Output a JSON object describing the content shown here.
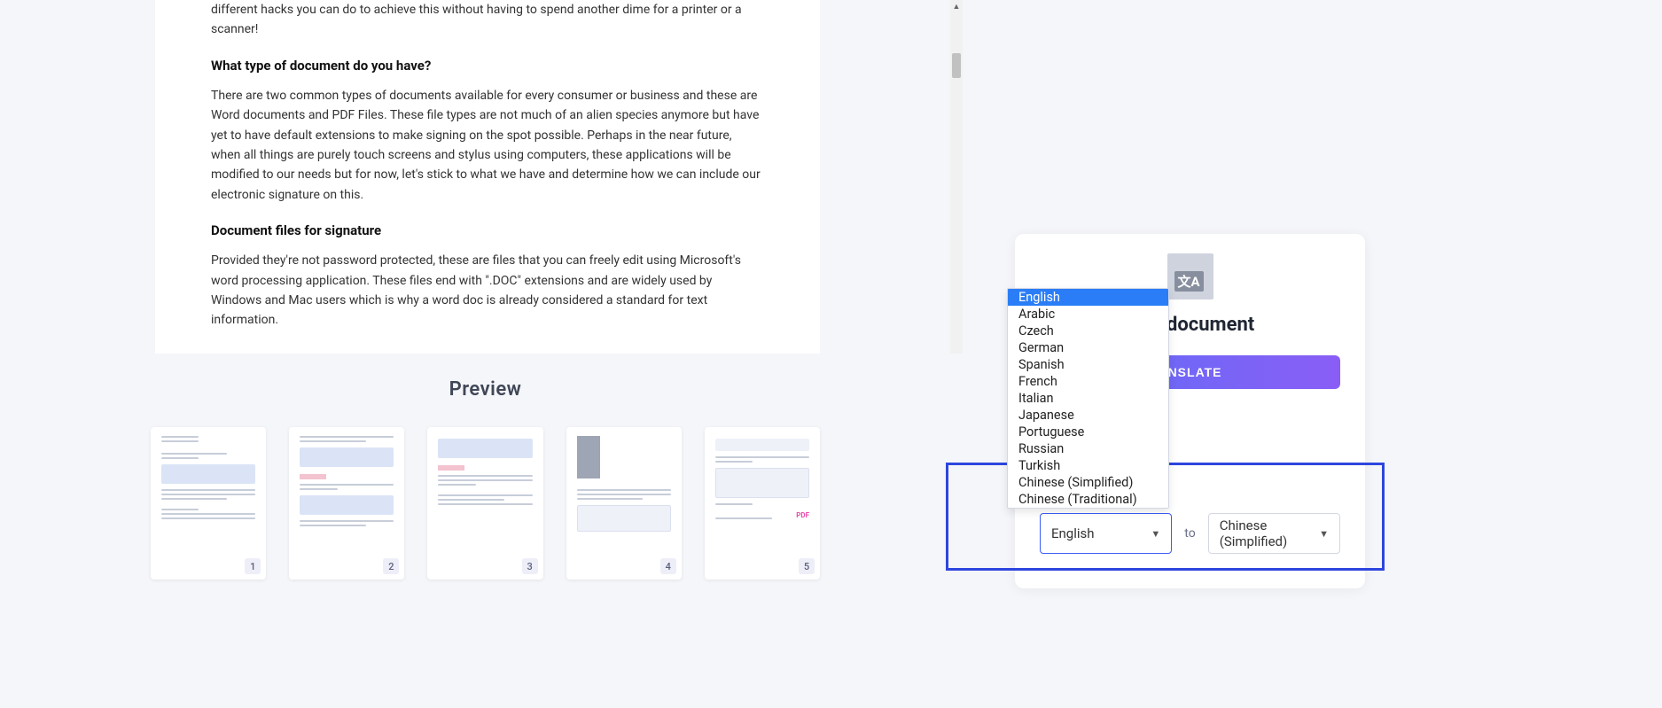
{
  "document": {
    "intro_cont": "different hacks you can do to achieve this without having to spend another dime for a printer or a scanner!",
    "h1": "What type of document do you have?",
    "p1": "There are two common types of documents available for every consumer or business and these are Word documents and PDF Files. These file types are not much of an alien species anymore but have yet to have default extensions to make signing on the spot possible. Perhaps in the near future, when all things are purely touch screens and stylus using computers, these applications will be modified to our needs but for now, let's stick to what we have and determine how we can include our electronic signature on this.",
    "h2": "Document files for signature",
    "p2": "Provided they're not password protected, these are files that you can freely edit using Microsoft's word processing application. These files end with \".DOC\" extensions and are widely used by Windows and Mac users which is why a word doc is already considered a standard for text information."
  },
  "preview": {
    "title": "Preview",
    "thumbs": [
      "1",
      "2",
      "3",
      "4",
      "5"
    ]
  },
  "side": {
    "title_suffix": "ls in document",
    "translate_btn": "ANSLATE",
    "to_label": "to",
    "source_selected": "English",
    "target_selected": "Chinese (Simplified)"
  },
  "dropdown": {
    "selected_index": 0,
    "options": [
      "English",
      "Arabic",
      "Czech",
      "German",
      "Spanish",
      "French",
      "Italian",
      "Japanese",
      "Portuguese",
      "Russian",
      "Turkish",
      "Chinese (Simplified)",
      "Chinese (Traditional)"
    ]
  }
}
